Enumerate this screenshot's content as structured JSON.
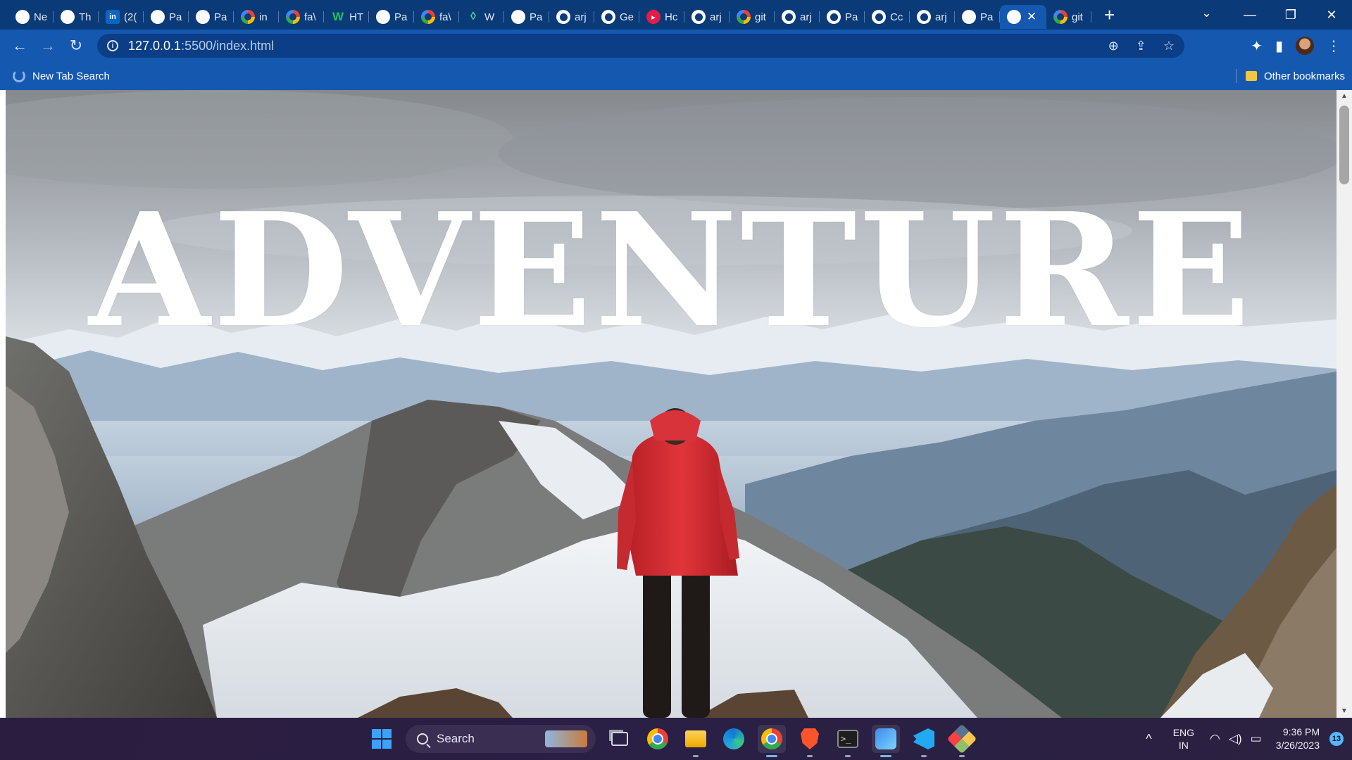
{
  "browser": {
    "tabs": [
      {
        "title": "Ne",
        "icon": "globe-icon",
        "kind": "globe"
      },
      {
        "title": "Th",
        "icon": "globe-icon",
        "kind": "globe"
      },
      {
        "title": "(2(",
        "icon": "linkedin-icon",
        "kind": "linkedin",
        "glyph": "in"
      },
      {
        "title": "Pa",
        "icon": "globe-icon",
        "kind": "globe"
      },
      {
        "title": "Pa",
        "icon": "globe-icon",
        "kind": "globe"
      },
      {
        "title": "in",
        "icon": "google-icon",
        "kind": "google"
      },
      {
        "title": "fa\\",
        "icon": "google-icon",
        "kind": "google"
      },
      {
        "title": "HT",
        "icon": "w-logo-icon",
        "kind": "w",
        "glyph": "W"
      },
      {
        "title": "Pa",
        "icon": "globe-icon",
        "kind": "globe"
      },
      {
        "title": "fa\\",
        "icon": "google-icon",
        "kind": "google"
      },
      {
        "title": "W",
        "icon": "leaf-icon",
        "kind": "leaf",
        "glyph": "◊"
      },
      {
        "title": "Pa",
        "icon": "globe-icon",
        "kind": "globe"
      },
      {
        "title": "arj",
        "icon": "github-icon",
        "kind": "github"
      },
      {
        "title": "Ge",
        "icon": "github-icon",
        "kind": "github"
      },
      {
        "title": "Hc",
        "icon": "red-circle-icon",
        "kind": "red",
        "glyph": "▸"
      },
      {
        "title": "arj",
        "icon": "github-icon",
        "kind": "github"
      },
      {
        "title": "git",
        "icon": "google-icon",
        "kind": "google"
      },
      {
        "title": "arj",
        "icon": "github-icon",
        "kind": "github"
      },
      {
        "title": "Pa",
        "icon": "github-icon",
        "kind": "github"
      },
      {
        "title": "Cc",
        "icon": "github-icon",
        "kind": "github"
      },
      {
        "title": "arj",
        "icon": "github-icon",
        "kind": "github"
      },
      {
        "title": "Pa",
        "icon": "globe-icon",
        "kind": "globe"
      },
      {
        "title": "",
        "icon": "globe-icon",
        "kind": "globe",
        "active": true
      },
      {
        "title": "git",
        "icon": "google-icon",
        "kind": "google"
      }
    ],
    "new_tab_glyph": "+",
    "tab_search_glyph": "⌄",
    "window_controls": {
      "minimize": "—",
      "restore": "❐",
      "close": "✕"
    },
    "toolbar": {
      "back_glyph": "←",
      "forward_glyph": "→",
      "reload_glyph": "↻",
      "url_host": "127.0.0.1",
      "url_path": ":5500/index.html",
      "info_glyph": "i",
      "zoom_glyph": "⊕",
      "share_glyph": "⇪",
      "star_glyph": "☆",
      "extensions_glyph": "✦",
      "sidepanel_glyph": "▮",
      "menu_glyph": "⋮"
    },
    "bookmarks": {
      "item": "New Tab Search",
      "other": "Other bookmarks"
    }
  },
  "page": {
    "hero_title": "ADVENTURE"
  },
  "scrollbar": {
    "up": "▲",
    "down": "▼",
    "position": 0.0
  },
  "taskbar": {
    "search_label": "Search",
    "tray": {
      "chevron": "^",
      "lang_line1": "ENG",
      "lang_line2": "IN",
      "wifi_glyph": "◠",
      "volume_glyph": "◁)",
      "battery_glyph": "▭",
      "time": "9:36 PM",
      "date": "3/26/2023",
      "notification_count": "13"
    }
  },
  "colors": {
    "tabstrip": "#0a3a78",
    "toolbar": "#1558b0",
    "omnibox": "#0b3e86",
    "hero_title": "#ffffff",
    "jacket": "#d42a30"
  }
}
